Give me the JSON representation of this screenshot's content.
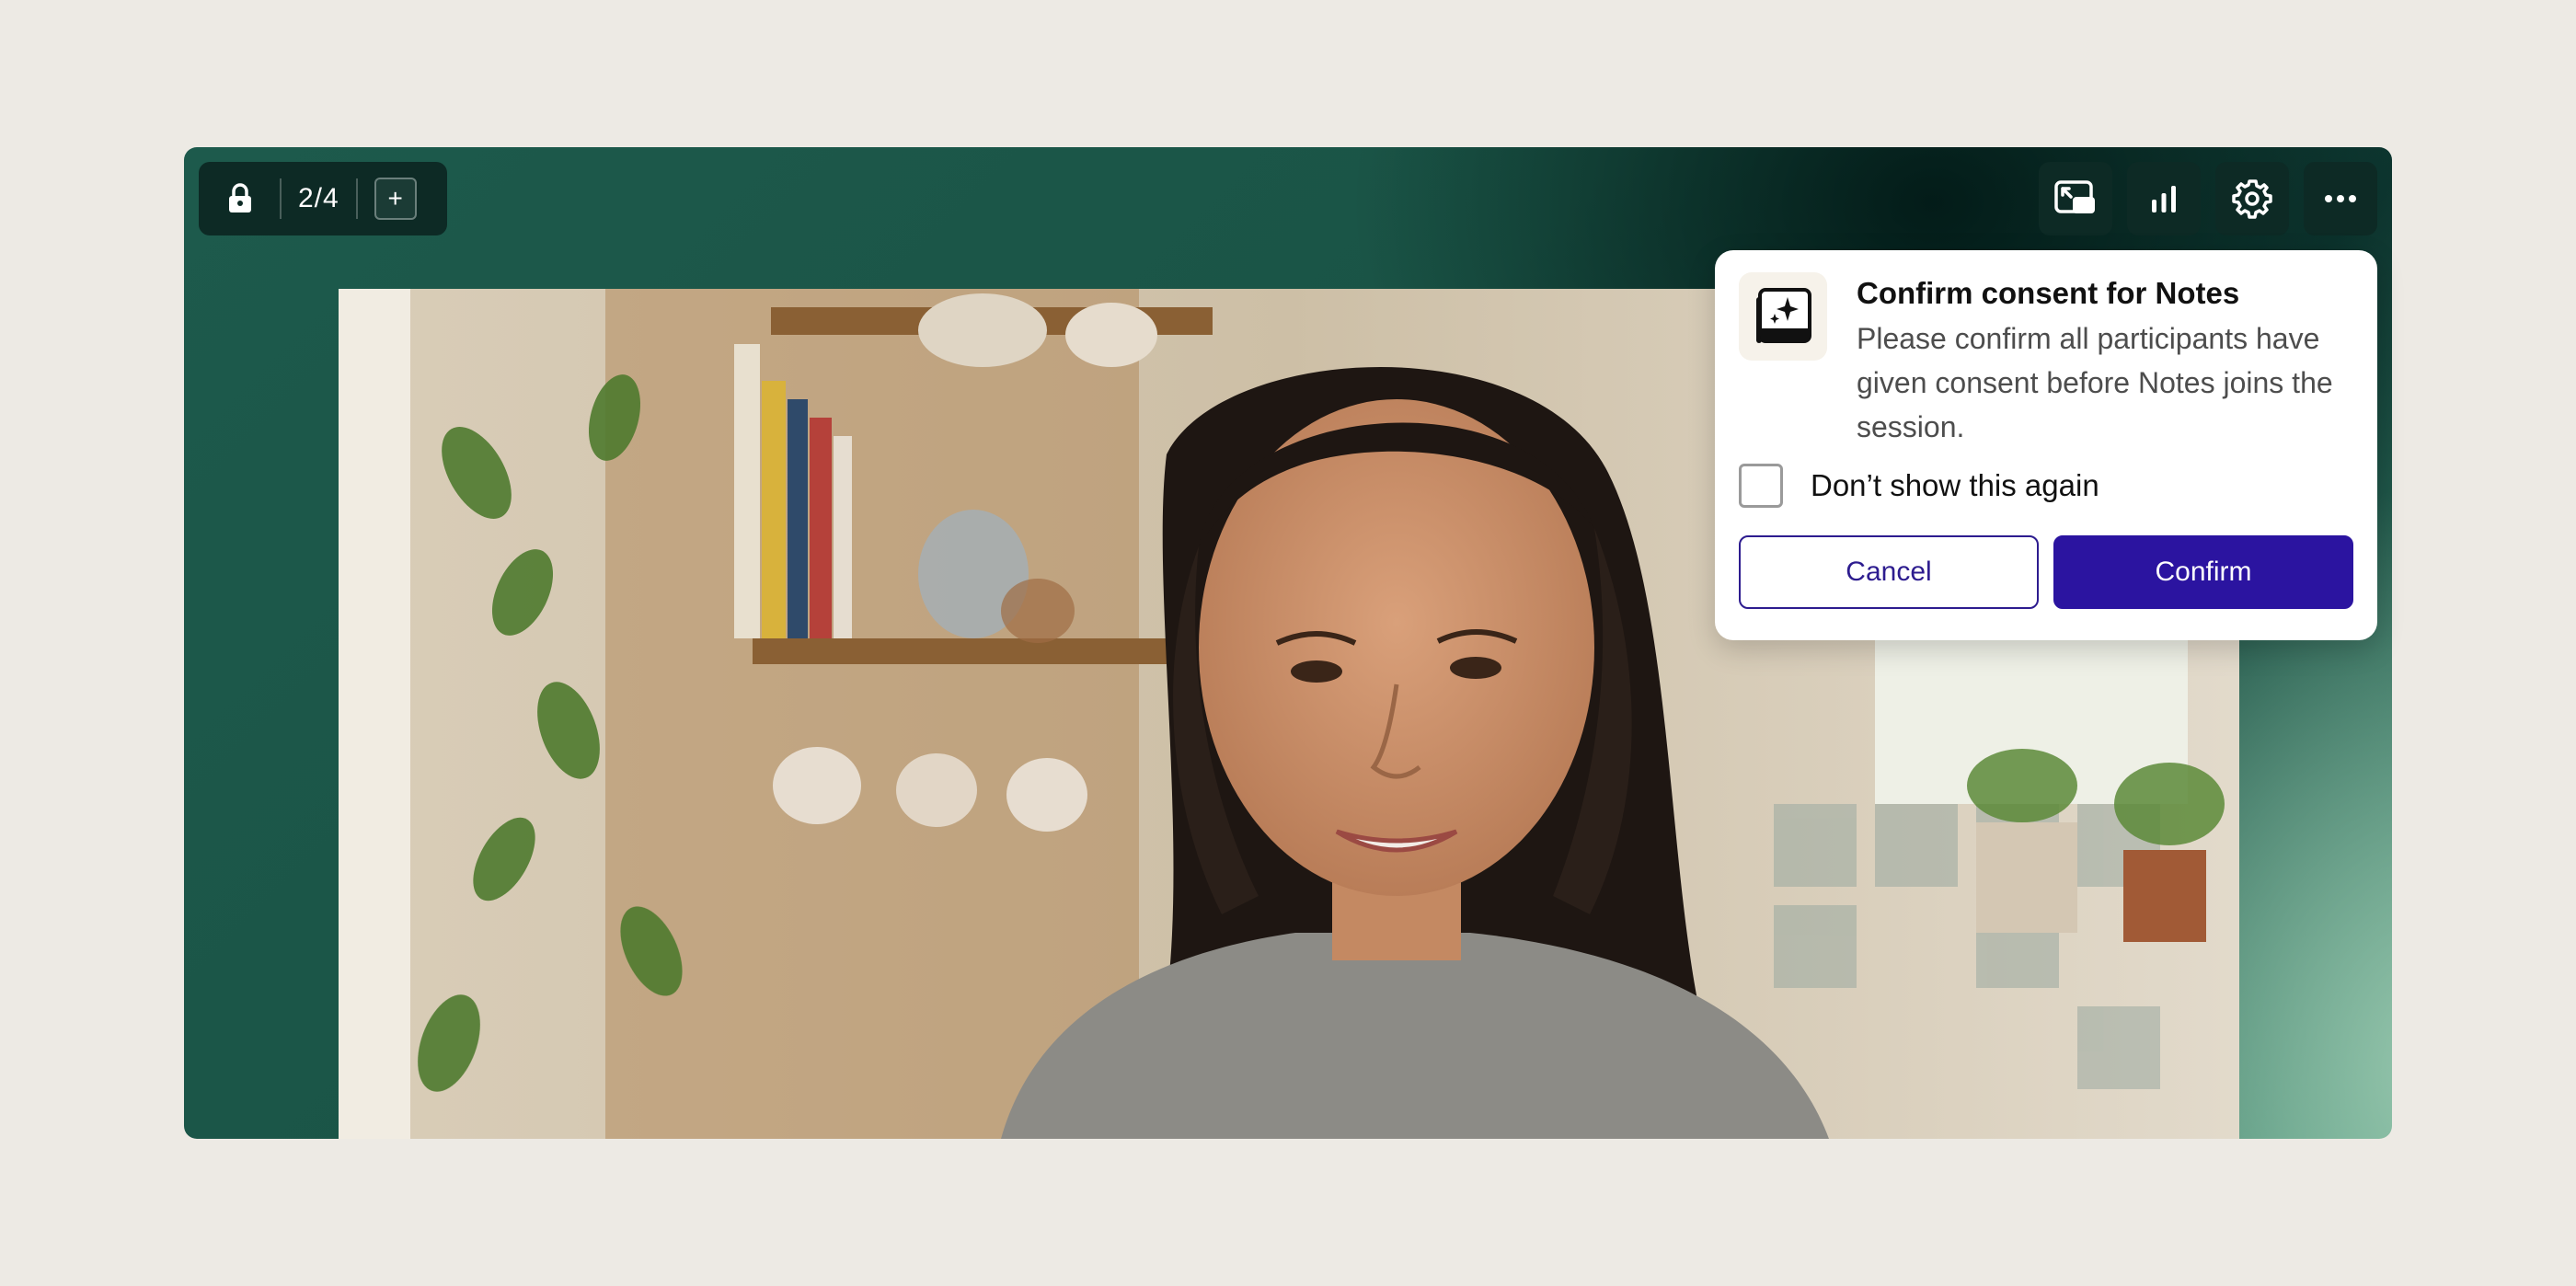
{
  "toolbar_left": {
    "lock_icon": "lock-icon",
    "page_indicator": "2/4",
    "add_label": "+"
  },
  "toolbar_right": {
    "buttons": [
      {
        "icon": "picture-in-picture-icon"
      },
      {
        "icon": "bar-chart-icon"
      },
      {
        "icon": "gear-icon"
      },
      {
        "icon": "more-horizontal-icon"
      }
    ]
  },
  "video": {
    "participant_icon": "participant-video"
  },
  "consent_dialog": {
    "icon": "notes-sparkle-icon",
    "title": "Confirm consent for Notes",
    "body": "Please confirm all participants have given consent before Notes joins the session.",
    "checkbox_label": "Don’t show this again",
    "checkbox_checked": false,
    "cancel_label": "Cancel",
    "confirm_label": "Confirm"
  },
  "colors": {
    "page_bg": "#edeae4",
    "toolbar_bg": "#0d2a25",
    "primary": "#2b14a0",
    "stage_green": "#1a5446"
  }
}
